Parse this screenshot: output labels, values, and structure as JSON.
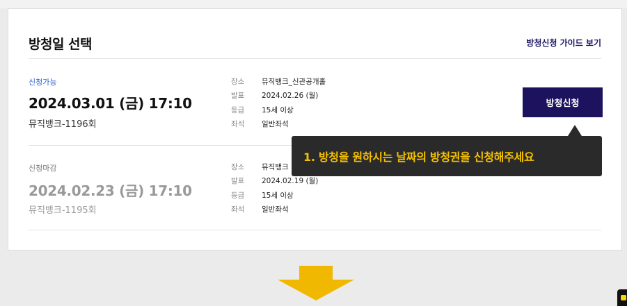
{
  "header": {
    "title": "방청일 선택",
    "guide_link": "방청신청 가이드 보기"
  },
  "labels": {
    "venue": "장소",
    "announce": "발표",
    "grade": "등급",
    "seat": "좌석"
  },
  "sessions": [
    {
      "status": "신청가능",
      "date": "2024.03.01 (금) 17:10",
      "episode": "뮤직뱅크-1196회",
      "venue": "뮤직뱅크_신관공개홀",
      "announce": "2024.02.26 (월)",
      "grade": "15세 이상",
      "seat": "일반좌석",
      "button": "방청신청"
    },
    {
      "status": "신청마감",
      "date": "2024.02.23 (금) 17:10",
      "episode": "뮤직뱅크-1195회",
      "venue": "뮤직뱅크",
      "announce": "2024.02.19 (월)",
      "grade": "15세 이상",
      "seat": "일반좌석"
    }
  ],
  "tooltip": {
    "text": "1. 방청을 원하시는 날짜의 방청권을 신청해주세요"
  },
  "colors": {
    "primary": "#1c125e",
    "status_open": "#2b63d6",
    "tooltip_text": "#f5c000",
    "arrow": "#f0b800"
  }
}
